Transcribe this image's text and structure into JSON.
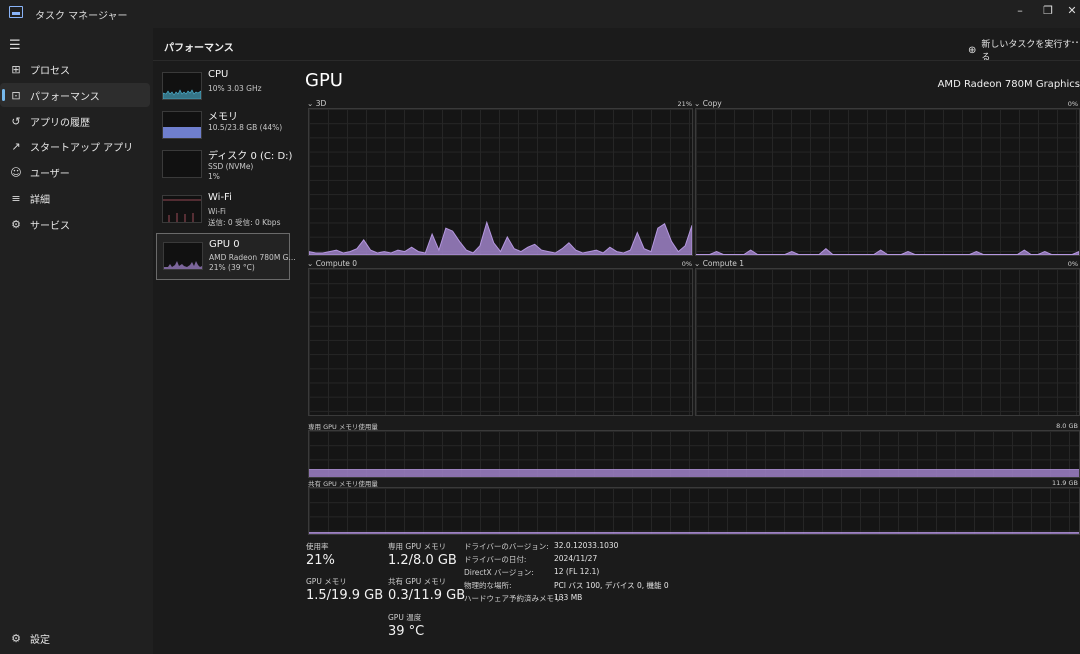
{
  "app": {
    "title": "タスク マネージャー"
  },
  "window_controls": {
    "minimize": "–",
    "restore": "❐",
    "close": "✕"
  },
  "nav": [
    {
      "label": "プロセス",
      "icon": "processes-icon"
    },
    {
      "label": "パフォーマンス",
      "icon": "performance-icon"
    },
    {
      "label": "アプリの履歴",
      "icon": "app-history-icon"
    },
    {
      "label": "スタートアップ アプリ",
      "icon": "startup-icon"
    },
    {
      "label": "ユーザー",
      "icon": "users-icon"
    },
    {
      "label": "詳細",
      "icon": "details-icon"
    },
    {
      "label": "サービス",
      "icon": "services-icon"
    }
  ],
  "settings_label": "設定",
  "header": {
    "title": "パフォーマンス",
    "run_task": "新しいタスクを実行する"
  },
  "resources": [
    {
      "name": "CPU",
      "sub1": "10% 3.03 GHz",
      "sub2": ""
    },
    {
      "name": "メモリ",
      "sub1": "10.5/23.8 GB (44%)",
      "sub2": ""
    },
    {
      "name": "ディスク 0 (C: D:)",
      "sub1": "SSD (NVMe)",
      "sub2": "1%"
    },
    {
      "name": "Wi-Fi",
      "sub1": "Wi-Fi",
      "sub2": "送信: 0  受信: 0 Kbps"
    },
    {
      "name": "GPU 0",
      "sub1": "AMD Radeon 780M G...",
      "sub2": "21% (39 °C)"
    }
  ],
  "gpu": {
    "title": "GPU",
    "model": "AMD Radeon 780M Graphics"
  },
  "graphs": {
    "g3d": {
      "label": "3D",
      "pct": "21%",
      "series": [
        2,
        1,
        1,
        2,
        3,
        1,
        2,
        4,
        10,
        3,
        1,
        2,
        1,
        3,
        2,
        5,
        2,
        1,
        14,
        3,
        18,
        16,
        9,
        3,
        1,
        6,
        22,
        8,
        2,
        12,
        4,
        2,
        5,
        7,
        3,
        2,
        1,
        4,
        8,
        3,
        1,
        2,
        3,
        1,
        5,
        2,
        1,
        3,
        15,
        4,
        2,
        18,
        21,
        9,
        2,
        6,
        20
      ]
    },
    "copy": {
      "label": "Copy",
      "pct": "0%",
      "series": [
        0,
        0,
        0,
        2,
        0,
        0,
        0,
        0,
        3,
        0,
        0,
        0,
        0,
        0,
        2,
        0,
        0,
        0,
        0,
        4,
        0,
        0,
        0,
        0,
        0,
        0,
        0,
        3,
        0,
        0,
        0,
        2,
        0,
        0,
        0,
        0,
        0,
        0,
        0,
        0,
        0,
        2,
        0,
        0,
        0,
        0,
        0,
        0,
        3,
        0,
        0,
        2,
        0,
        0,
        0,
        0,
        2
      ]
    },
    "compute0": {
      "label": "Compute 0",
      "pct": "0%"
    },
    "compute1": {
      "label": "Compute 1",
      "pct": "0%"
    },
    "dedicated": {
      "label": "専用 GPU メモリ使用量",
      "max": "8.0 GB",
      "fill_fraction": 0.15
    },
    "shared": {
      "label": "共有 GPU メモリ使用量",
      "max": "11.9 GB",
      "fill_fraction": 0.025
    }
  },
  "stats": {
    "usage_label": "使用率",
    "usage_value": "21%",
    "gpu_mem_label": "GPU メモリ",
    "gpu_mem_value": "1.5/19.9 GB",
    "ded_label": "専用 GPU メモリ",
    "ded_value": "1.2/8.0 GB",
    "shared_label": "共有 GPU メモリ",
    "shared_value": "0.3/11.9 GB",
    "temp_label": "GPU 温度",
    "temp_value": "39 °C"
  },
  "info": [
    {
      "k": "ドライバーのバージョン:",
      "v": "32.0.12033.1030"
    },
    {
      "k": "ドライバーの日付:",
      "v": "2024/11/27"
    },
    {
      "k": "DirectX バージョン:",
      "v": "12 (FL 12.1)"
    },
    {
      "k": "物理的な場所:",
      "v": "PCI バス 100, デバイス 0, 機能 0"
    },
    {
      "k": "ハードウェア予約済みメモリ:",
      "v": "133 MB"
    }
  ],
  "colors": {
    "gpu_fill": "#9f82c8",
    "gpu_line": "#b597e0",
    "memory": "#6f7fce",
    "cpu": "#4eb7d6",
    "accent": "#76b9ed"
  }
}
